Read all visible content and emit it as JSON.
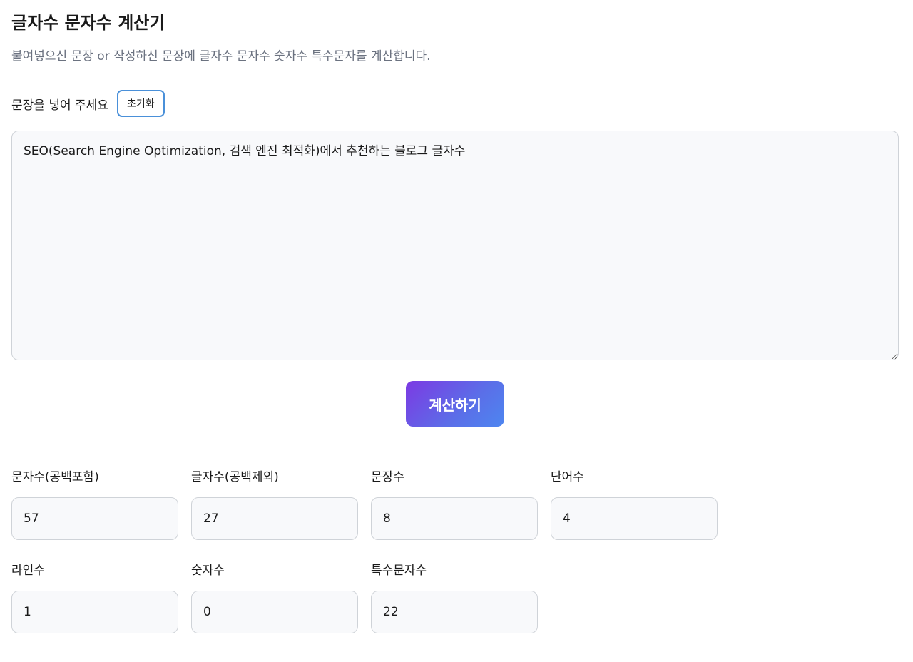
{
  "header": {
    "title": "글자수 문자수 계산기",
    "subtitle": "붙여넣으신 문장 or 작성하신 문장에 글자수 문자수 숫자수 특수문자를 계산합니다."
  },
  "input": {
    "label": "문장을 넣어 주세요",
    "reset_label": "초기화",
    "value": "SEO(Search Engine Optimization, 검색 엔진 최적화)에서 추천하는 블로그 글자수"
  },
  "calculate_label": "계산하기",
  "results": [
    {
      "label": "문자수(공백포함)",
      "value": "57"
    },
    {
      "label": "글자수(공백제외)",
      "value": "27"
    },
    {
      "label": "문장수",
      "value": "8"
    },
    {
      "label": "단어수",
      "value": "4"
    },
    {
      "label": "라인수",
      "value": "1"
    },
    {
      "label": "숫자수",
      "value": "0"
    },
    {
      "label": "특수문자수",
      "value": "22"
    }
  ],
  "colors": {
    "accent_border": "#4a90d9",
    "button_gradient_start": "#7c3ae3",
    "button_gradient_end": "#4d86f0",
    "field_background": "#f8f9fb",
    "subtitle_text": "#6b7280"
  }
}
